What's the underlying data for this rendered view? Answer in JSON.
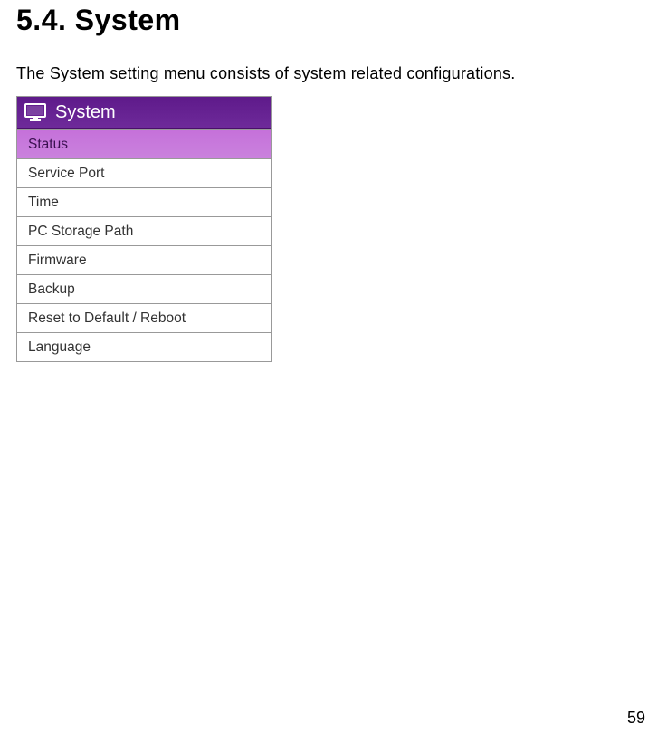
{
  "heading": "5.4.  System",
  "description": "The System setting menu consists of system related configurations.",
  "menu": {
    "title": "System",
    "items": [
      {
        "label": "Status",
        "selected": true
      },
      {
        "label": "Service Port",
        "selected": false
      },
      {
        "label": "Time",
        "selected": false
      },
      {
        "label": "PC Storage Path",
        "selected": false
      },
      {
        "label": "Firmware",
        "selected": false
      },
      {
        "label": "Backup",
        "selected": false
      },
      {
        "label": "Reset to Default / Reboot",
        "selected": false
      },
      {
        "label": "Language",
        "selected": false
      }
    ]
  },
  "pageNumber": "59"
}
